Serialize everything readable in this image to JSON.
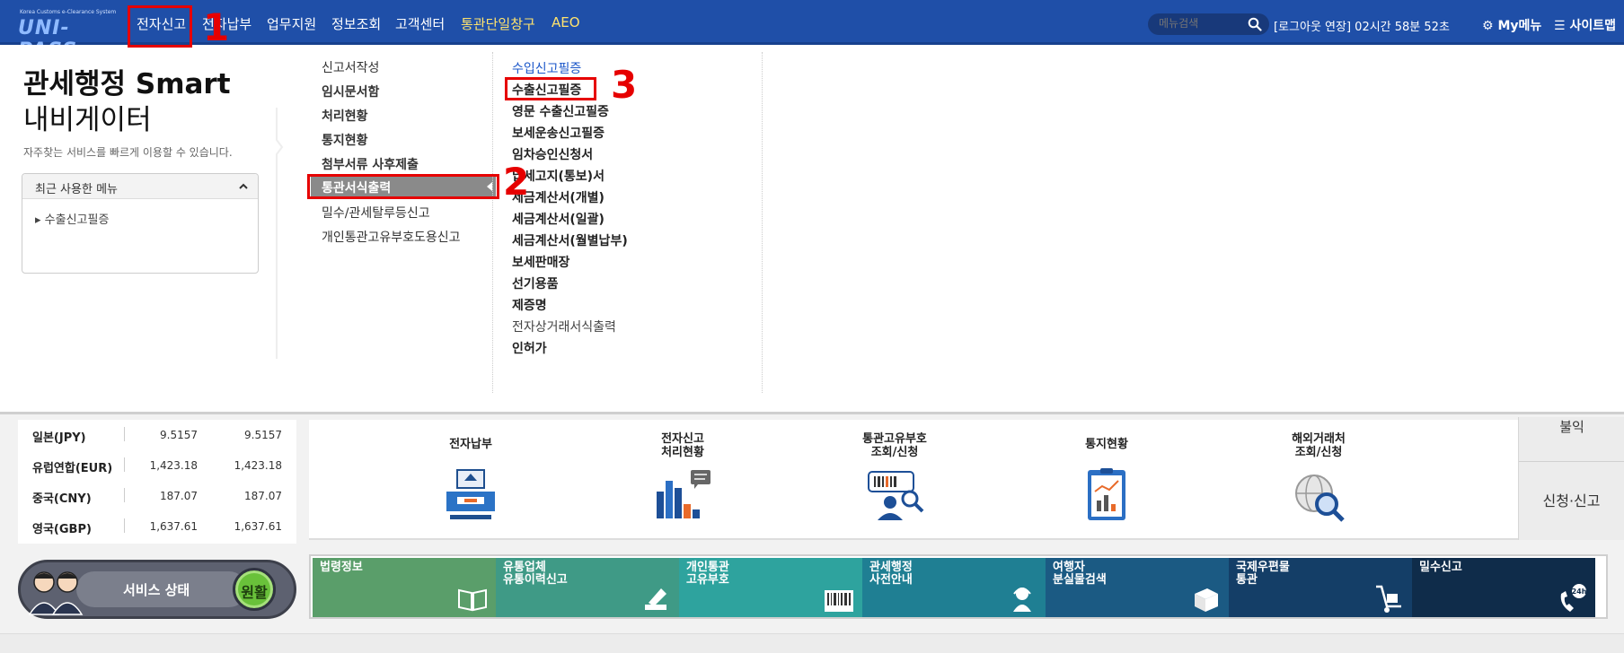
{
  "header": {
    "logo": {
      "tagline": "Korea Customs e-Clearance System",
      "text": "UNI-PASS"
    },
    "gnb": [
      "전자신고",
      "전자납부",
      "업무지원",
      "정보조회",
      "고객센터",
      "통관단일창구",
      "AEO"
    ],
    "search": {
      "placeholder": "메뉴검색"
    },
    "logout_timer": "[로그아웃 연장] 02시간 58분 52초",
    "my_menu": "My메뉴",
    "sitemap": "사이트맵"
  },
  "annotations": {
    "marker1": "1",
    "marker2": "2",
    "marker3": "3"
  },
  "navigator": {
    "title_bold": "관세행정 Smart",
    "title_light": "내비게이터",
    "description": "자주찾는 서비스를 빠르게 이용할 수 있습니다.",
    "recent_title": "최근 사용한 메뉴",
    "recent_items": [
      "▸ 수출신고필증"
    ]
  },
  "submenu_left": {
    "items": [
      "신고서작성",
      "임시문서함",
      "처리현황",
      "통지현황",
      "첨부서류 사후제출",
      "통관서식출력",
      "밀수/관세탈루등신고",
      "개인통관고유부호도용신고"
    ],
    "active": "통관서식출력"
  },
  "submenu_right": {
    "items": [
      "수입신고필증",
      "수출신고필증",
      "영문 수출신고필증",
      "보세운송신고필증",
      "임차승인신청서",
      "납세고지(통보)서",
      "세금계산서(개별)",
      "세금계산서(일괄)",
      "세금계산서(월별납부)",
      "보세판매장",
      "선기용품",
      "제증명",
      "전자상거래서식출력",
      "인허가"
    ]
  },
  "exchange_rates": [
    {
      "currency": "일본(JPY)",
      "v1": "9.5157",
      "v2": "9.5157"
    },
    {
      "currency": "유럽연합(EUR)",
      "v1": "1,423.18",
      "v2": "1,423.18"
    },
    {
      "currency": "중국(CNY)",
      "v1": "187.07",
      "v2": "187.07"
    },
    {
      "currency": "영국(GBP)",
      "v1": "1,637.61",
      "v2": "1,637.61"
    }
  ],
  "services": [
    {
      "line1": "전자납부",
      "line2": ""
    },
    {
      "line1": "전자신고",
      "line2": "처리현황"
    },
    {
      "line1": "통관고유부호",
      "line2": "조회/신청"
    },
    {
      "line1": "통지현황",
      "line2": ""
    },
    {
      "line1": "해외거래처",
      "line2": "조회/신청"
    }
  ],
  "right_tab": {
    "top_label": "불익",
    "label": "신청·신고"
  },
  "service_status": {
    "label": "서비스 상태",
    "value": "원활"
  },
  "tiles": [
    {
      "label": "법령정보",
      "color": "#5a9e6a"
    },
    {
      "label": "유통업체\n유통이력신고",
      "color": "#3f9a86"
    },
    {
      "label": "개인통관\n고유부호",
      "color": "#2ea39e"
    },
    {
      "label": "관세행정\n사전안내",
      "color": "#1f7f93"
    },
    {
      "label": "여행자\n분실물검색",
      "color": "#1b5a83"
    },
    {
      "label": "국제우편물\n통관",
      "color": "#143e67"
    },
    {
      "label": "밀수신고",
      "color": "#0f2c4a"
    }
  ],
  "colors": {
    "header_bg": "#1f4fa8",
    "highlight": "#e60000",
    "link_blue": "#1a56c9"
  }
}
